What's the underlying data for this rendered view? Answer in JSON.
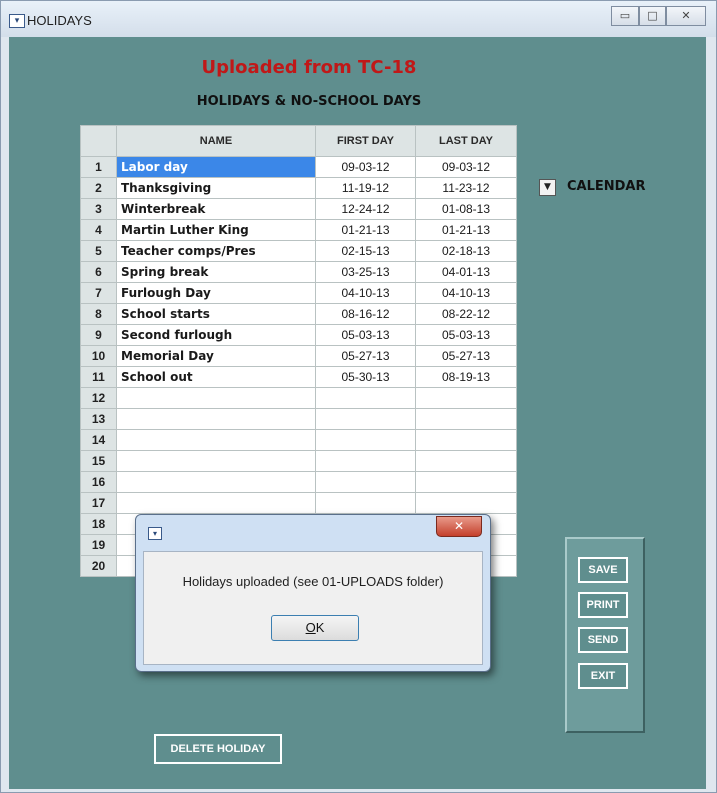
{
  "window": {
    "title": "HOLIDAYS",
    "controls": {
      "minimize": "▭",
      "maximize": "□",
      "close": "✕"
    }
  },
  "header": {
    "upload_title": "Uploaded from TC-18",
    "subtitle": "HOLIDAYS & NO-SCHOOL DAYS"
  },
  "table": {
    "columns": [
      "NAME",
      "FIRST DAY",
      "LAST DAY"
    ],
    "selected_row": 1,
    "rows": [
      {
        "num": "1",
        "name": "Labor day",
        "first": "09-03-12",
        "last": "09-03-12"
      },
      {
        "num": "2",
        "name": "Thanksgiving",
        "first": "11-19-12",
        "last": "11-23-12"
      },
      {
        "num": "3",
        "name": "Winterbreak",
        "first": "12-24-12",
        "last": "01-08-13"
      },
      {
        "num": "4",
        "name": "Martin Luther King",
        "first": "01-21-13",
        "last": "01-21-13"
      },
      {
        "num": "5",
        "name": "Teacher comps/Pres",
        "first": "02-15-13",
        "last": "02-18-13"
      },
      {
        "num": "6",
        "name": "Spring break",
        "first": "03-25-13",
        "last": "04-01-13"
      },
      {
        "num": "7",
        "name": "Furlough Day",
        "first": "04-10-13",
        "last": "04-10-13"
      },
      {
        "num": "8",
        "name": "School starts",
        "first": "08-16-12",
        "last": "08-22-12"
      },
      {
        "num": "9",
        "name": "Second furlough",
        "first": "05-03-13",
        "last": "05-03-13"
      },
      {
        "num": "10",
        "name": "Memorial Day",
        "first": "05-27-13",
        "last": "05-27-13"
      },
      {
        "num": "11",
        "name": "School out",
        "first": "05-30-13",
        "last": "08-19-13"
      },
      {
        "num": "12",
        "name": "",
        "first": "",
        "last": ""
      },
      {
        "num": "13",
        "name": "",
        "first": "",
        "last": ""
      },
      {
        "num": "14",
        "name": "",
        "first": "",
        "last": ""
      },
      {
        "num": "15",
        "name": "",
        "first": "",
        "last": ""
      },
      {
        "num": "16",
        "name": "",
        "first": "",
        "last": ""
      },
      {
        "num": "17",
        "name": "",
        "first": "",
        "last": ""
      },
      {
        "num": "18",
        "name": "",
        "first": "",
        "last": ""
      },
      {
        "num": "19",
        "name": "",
        "first": "",
        "last": ""
      },
      {
        "num": "20",
        "name": "",
        "first": "",
        "last": ""
      }
    ]
  },
  "calendar": {
    "label": "CALENDAR",
    "icon": "dropdown-arrow-icon"
  },
  "buttons": {
    "save": "SAVE",
    "print": "PRINT",
    "send": "SEND",
    "exit": "EXIT",
    "delete": "DELETE HOLIDAY"
  },
  "dialog": {
    "message": "Holidays uploaded (see 01-UPLOADS folder)",
    "ok_underline": "O",
    "ok_rest": "K",
    "close": "✕"
  }
}
